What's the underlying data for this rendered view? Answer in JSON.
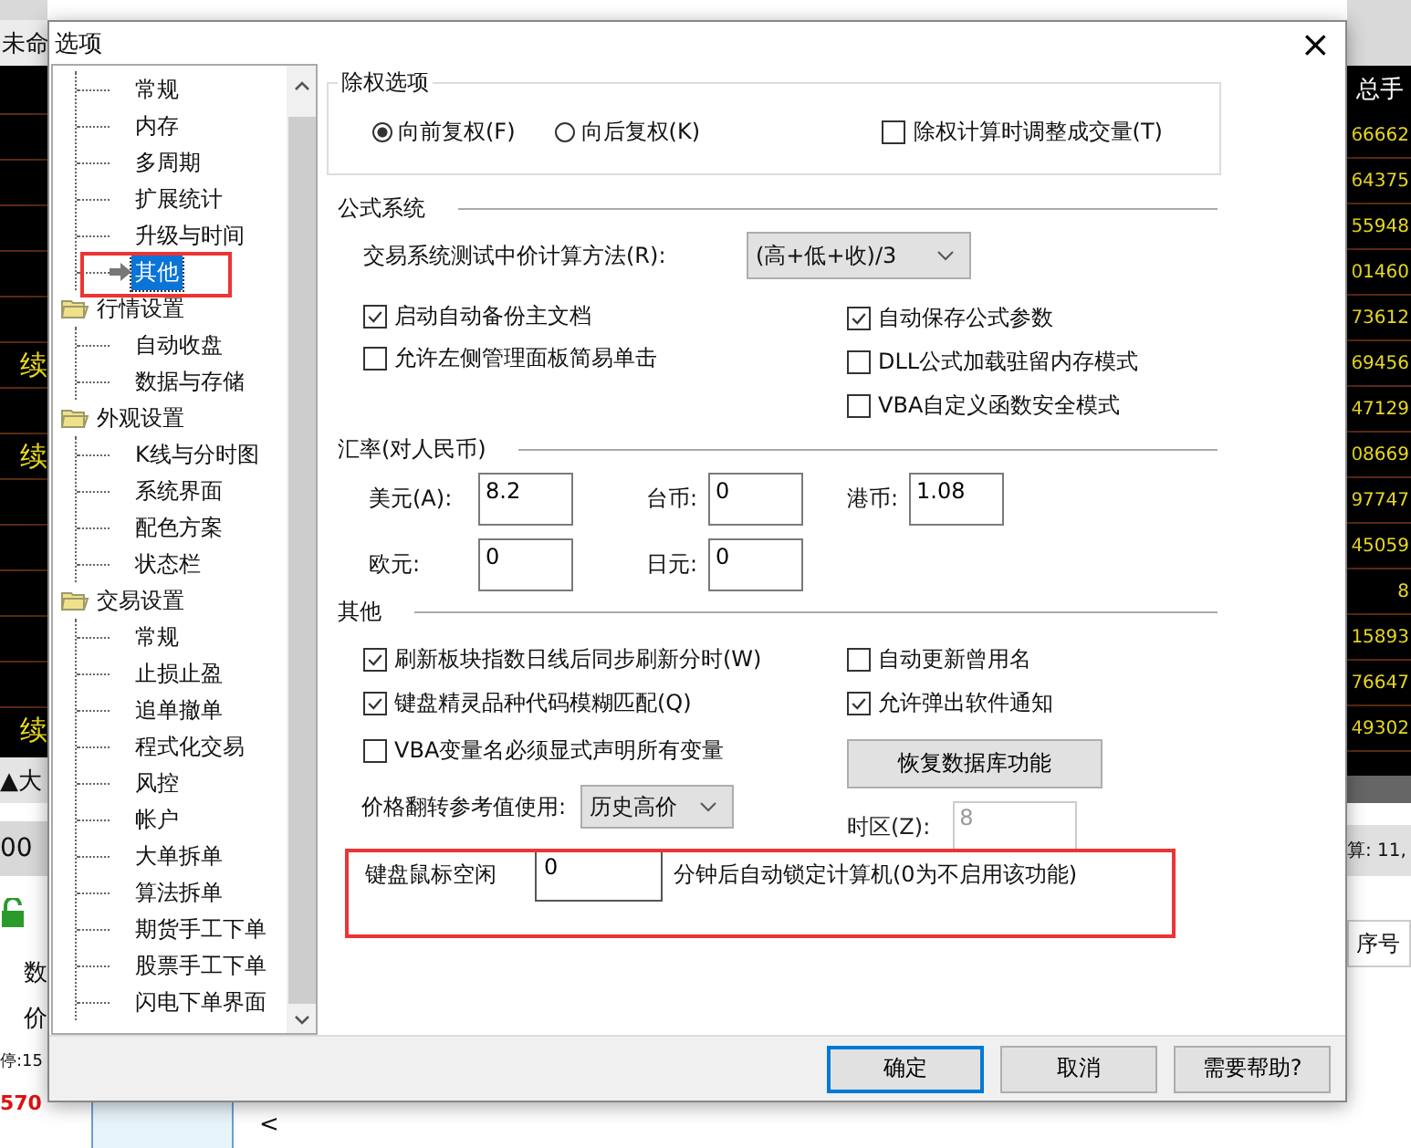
{
  "background_app": {
    "title": "未命",
    "left_cells": [
      null,
      null,
      null,
      null,
      null,
      "续",
      null,
      "续",
      null,
      null,
      null,
      null,
      null,
      "续"
    ],
    "left_tab": "▲大",
    "left_value": "00",
    "left_labels": [
      "数",
      "价"
    ],
    "left_status": "停:15",
    "left_price": "570",
    "right_header": "总手",
    "right_values": [
      "66662",
      "64375",
      "55948",
      "01460",
      "73612",
      "69456",
      "47129",
      "08669",
      "97747",
      "45059",
      "8",
      "15893",
      "76647",
      "49302"
    ],
    "right_status": "算: 11,",
    "right_column": "序号",
    "bottom_arrow": "<"
  },
  "dialog": {
    "title": "选项",
    "close": "×"
  },
  "tree": [
    {
      "children": [
        {
          "label": "常规",
          "selected": false
        },
        {
          "label": "内存",
          "selected": false
        },
        {
          "label": "多周期",
          "selected": false
        },
        {
          "label": "扩展统计",
          "selected": false
        },
        {
          "label": "升级与时间",
          "selected": false
        },
        {
          "label": "其他",
          "selected": true
        }
      ]
    },
    {
      "label": "行情设置",
      "expanded": true,
      "children": [
        {
          "label": "自动收盘",
          "selected": false
        },
        {
          "label": "数据与存储",
          "selected": false
        }
      ]
    },
    {
      "label": "外观设置",
      "expanded": true,
      "children": [
        {
          "label": "K线与分时图",
          "selected": false
        },
        {
          "label": "系统界面",
          "selected": false
        },
        {
          "label": "配色方案",
          "selected": false
        },
        {
          "label": "状态栏",
          "selected": false
        }
      ]
    },
    {
      "label": "交易设置",
      "expanded": true,
      "children": [
        {
          "label": "常规",
          "selected": false
        },
        {
          "label": "止损止盈",
          "selected": false
        },
        {
          "label": "追单撤单",
          "selected": false
        },
        {
          "label": "程式化交易",
          "selected": false
        },
        {
          "label": "风控",
          "selected": false
        },
        {
          "label": "帐户",
          "selected": false
        },
        {
          "label": "大单拆单",
          "selected": false
        },
        {
          "label": "算法拆单",
          "selected": false
        },
        {
          "label": "期货手工下单",
          "selected": false
        },
        {
          "label": "股票手工下单",
          "selected": false
        },
        {
          "label": "闪电下单界面",
          "selected": false
        }
      ]
    }
  ],
  "exright": {
    "title": "除权选项",
    "radios": [
      {
        "label": "向前复权(F)",
        "selected": true
      },
      {
        "label": "向后复权(K)",
        "selected": false
      }
    ],
    "option": {
      "label": "除权计算时调整成交量(T)",
      "checked": false
    }
  },
  "formula": {
    "title": "公式系统",
    "method_label": "交易系统测试中价计算方法(R):",
    "method_value": "(高+低+收)/3",
    "left_checks": [
      {
        "label": "启动自动备份主文档",
        "checked": true
      },
      {
        "label": "允许左侧管理面板简易单击",
        "checked": false
      }
    ],
    "right_checks": [
      {
        "label": "自动保存公式参数",
        "checked": true
      },
      {
        "label": "DLL公式加载驻留内存模式",
        "checked": false
      },
      {
        "label": "VBA自定义函数安全模式",
        "checked": false
      }
    ]
  },
  "rates": {
    "title": "汇率(对人民币)",
    "rows": [
      [
        {
          "label": "美元(A):",
          "value": "8.2"
        },
        {
          "label": "台币:",
          "value": "0"
        },
        {
          "label": "港币:",
          "value": "1.08"
        }
      ],
      [
        {
          "label": "欧元:",
          "value": "0"
        },
        {
          "label": "日元:",
          "value": "0"
        }
      ]
    ]
  },
  "other": {
    "title": "其他",
    "left_checks": [
      {
        "label": "刷新板块指数日线后同步刷新分时(W)",
        "checked": true
      },
      {
        "label": "键盘精灵品种代码模糊匹配(Q)",
        "checked": true
      },
      {
        "label": "VBA变量名必须显式声明所有变量",
        "checked": false
      }
    ],
    "right_checks": [
      {
        "label": "自动更新曾用名",
        "checked": false
      },
      {
        "label": "允许弹出软件通知",
        "checked": true
      }
    ],
    "restore_button": "恢复数据库功能",
    "flip_label": "价格翻转参考值使用:",
    "flip_value": "历史高价",
    "zone_label": "时区(Z):",
    "zone_value": "8",
    "zone_disabled": true,
    "idle_label": "键盘鼠标空闲",
    "idle_value": "0",
    "idle_suffix": "分钟后自动锁定计算机(0为不启用该功能)"
  },
  "buttons": [
    {
      "label": "确定",
      "default": true
    },
    {
      "label": "取消",
      "default": false
    },
    {
      "label": "需要帮助?",
      "default": false
    }
  ]
}
